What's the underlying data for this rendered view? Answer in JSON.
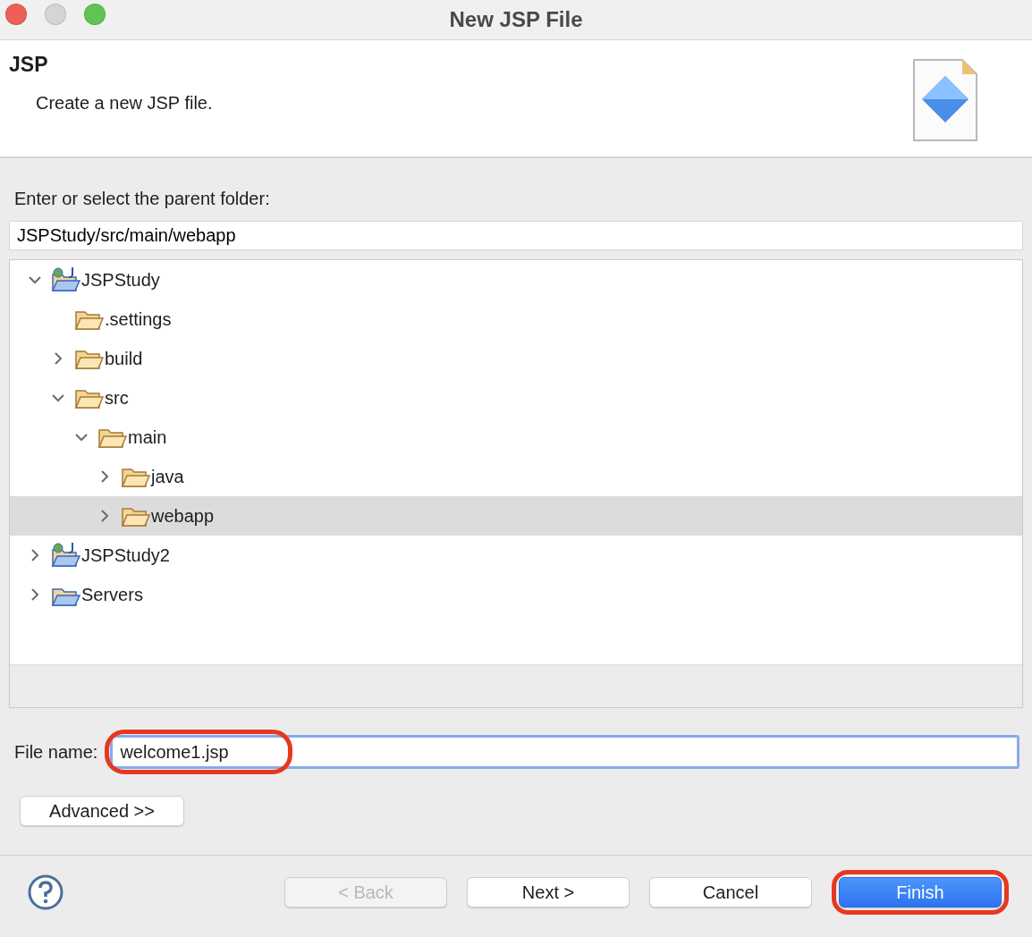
{
  "window": {
    "title": "New JSP File"
  },
  "header": {
    "title": "JSP",
    "description": "Create a new JSP file."
  },
  "parent_folder": {
    "label": "Enter or select the parent folder:",
    "value": "JSPStudy/src/main/webapp"
  },
  "tree": [
    {
      "label": "JSPStudy",
      "kind": "project",
      "expanded": true,
      "selected": false,
      "children": [
        {
          "label": ".settings",
          "kind": "folder",
          "selected": false
        },
        {
          "label": "build",
          "kind": "folder",
          "expanded": false,
          "selected": false
        },
        {
          "label": "src",
          "kind": "folder",
          "expanded": true,
          "selected": false,
          "children": [
            {
              "label": "main",
              "kind": "folder",
              "expanded": true,
              "selected": false,
              "children": [
                {
                  "label": "java",
                  "kind": "folder",
                  "expanded": false,
                  "selected": false
                },
                {
                  "label": "webapp",
                  "kind": "folder",
                  "expanded": false,
                  "selected": true
                }
              ]
            }
          ]
        }
      ]
    },
    {
      "label": "JSPStudy2",
      "kind": "project",
      "expanded": false,
      "selected": false
    },
    {
      "label": "Servers",
      "kind": "servers",
      "expanded": false,
      "selected": false
    }
  ],
  "file_name": {
    "label": "File name:",
    "value": "welcome1.jsp",
    "highlighted": true
  },
  "advanced_button": "Advanced >>",
  "buttons": [
    {
      "label": "< Back",
      "disabled": true,
      "default": false,
      "highlighted": false
    },
    {
      "label": "Next >",
      "disabled": false,
      "default": false,
      "highlighted": false
    },
    {
      "label": "Cancel",
      "disabled": false,
      "default": false,
      "highlighted": false
    },
    {
      "label": "Finish",
      "disabled": false,
      "default": true,
      "highlighted": true
    }
  ]
}
